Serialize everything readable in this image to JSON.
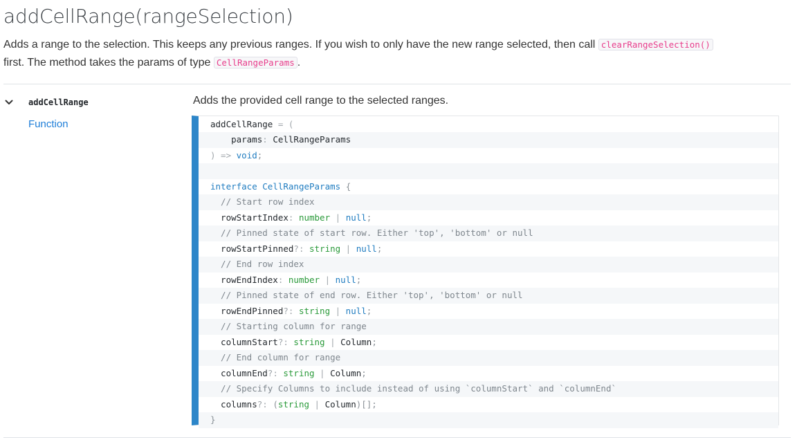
{
  "heading": {
    "title": "addCellRange(rangeSelection)",
    "desc_part1": "Adds a range to the selection. This keeps any previous ranges. If you wish to only have the new range selected, then call ",
    "desc_code1": "clearRangeSelection()",
    "desc_part2": " first. The method takes the params of type ",
    "desc_code2": "CellRangeParams",
    "desc_part3": "."
  },
  "property": {
    "name": "addCellRange",
    "type_label": "Function",
    "description": "Adds the provided cell range to the selected ranges.",
    "expand_icon": "chevron-down-icon"
  },
  "code_lines": [
    [
      [
        "id",
        "addCellRange "
      ],
      [
        "op",
        "= ("
      ]
    ],
    [
      [
        "id",
        "    params"
      ],
      [
        "op",
        ": "
      ],
      [
        "id",
        "CellRangeParams"
      ]
    ],
    [
      [
        "op",
        ") => "
      ],
      [
        "kw",
        "void"
      ],
      [
        "pu",
        ";"
      ]
    ],
    [],
    [
      [
        "kw",
        "interface "
      ],
      [
        "kw",
        "CellRangeParams "
      ],
      [
        "pu",
        "{"
      ]
    ],
    [
      [
        "cm",
        "  // Start row index"
      ]
    ],
    [
      [
        "id",
        "  rowStartIndex"
      ],
      [
        "op",
        ": "
      ],
      [
        "type",
        "number"
      ],
      [
        "op",
        " | "
      ],
      [
        "null",
        "null"
      ],
      [
        "pu",
        ";"
      ]
    ],
    [
      [
        "cm",
        "  // Pinned state of start row. Either 'top', 'bottom' or null"
      ]
    ],
    [
      [
        "id",
        "  rowStartPinned"
      ],
      [
        "op",
        "?: "
      ],
      [
        "type",
        "string"
      ],
      [
        "op",
        " | "
      ],
      [
        "null",
        "null"
      ],
      [
        "pu",
        ";"
      ]
    ],
    [
      [
        "cm",
        "  // End row index"
      ]
    ],
    [
      [
        "id",
        "  rowEndIndex"
      ],
      [
        "op",
        ": "
      ],
      [
        "type",
        "number"
      ],
      [
        "op",
        " | "
      ],
      [
        "null",
        "null"
      ],
      [
        "pu",
        ";"
      ]
    ],
    [
      [
        "cm",
        "  // Pinned state of end row. Either 'top', 'bottom' or null"
      ]
    ],
    [
      [
        "id",
        "  rowEndPinned"
      ],
      [
        "op",
        "?: "
      ],
      [
        "type",
        "string"
      ],
      [
        "op",
        " | "
      ],
      [
        "null",
        "null"
      ],
      [
        "pu",
        ";"
      ]
    ],
    [
      [
        "cm",
        "  // Starting column for range"
      ]
    ],
    [
      [
        "id",
        "  columnStart"
      ],
      [
        "op",
        "?: "
      ],
      [
        "type",
        "string"
      ],
      [
        "op",
        " | "
      ],
      [
        "id",
        "Column"
      ],
      [
        "pu",
        ";"
      ]
    ],
    [
      [
        "cm",
        "  // End column for range"
      ]
    ],
    [
      [
        "id",
        "  columnEnd"
      ],
      [
        "op",
        "?: "
      ],
      [
        "type",
        "string"
      ],
      [
        "op",
        " | "
      ],
      [
        "id",
        "Column"
      ],
      [
        "pu",
        ";"
      ]
    ],
    [
      [
        "cm",
        "  // Specify Columns to include instead of using `columnStart` and `columnEnd`"
      ]
    ],
    [
      [
        "id",
        "  columns"
      ],
      [
        "op",
        "?: "
      ],
      [
        "pu",
        "("
      ],
      [
        "type",
        "string"
      ],
      [
        "op",
        " | "
      ],
      [
        "id",
        "Column"
      ],
      [
        "pu",
        ")[];"
      ]
    ],
    [
      [
        "pu",
        "}"
      ]
    ]
  ],
  "colors": {
    "accent_bar": "#2d86c9",
    "link": "#1e7ed8",
    "inline_code": "#e83e8c"
  }
}
